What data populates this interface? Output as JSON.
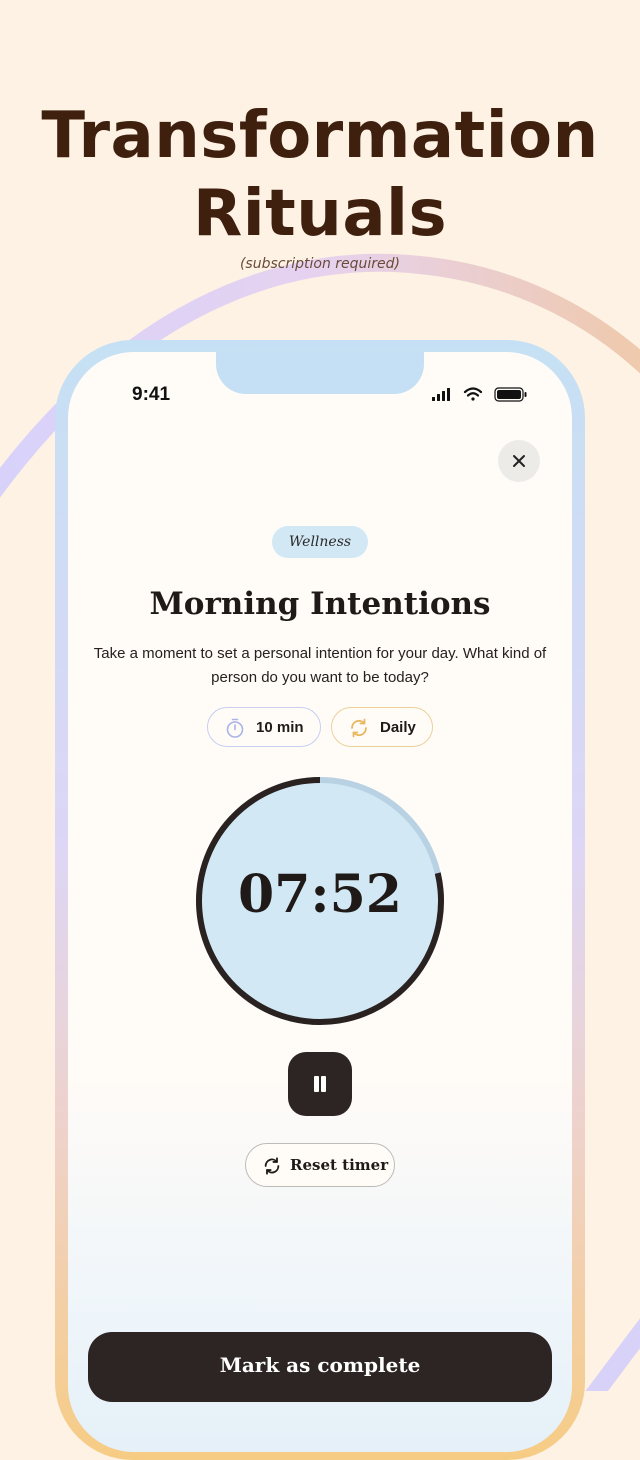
{
  "headline": {
    "line1": "Transformation",
    "line2": "Rituals",
    "note": "(subscription required)"
  },
  "status_bar": {
    "time": "9:41"
  },
  "ritual": {
    "category": "Wellness",
    "title": "Morning Intentions",
    "description": "Take a moment to set a personal intention for your day. What kind of person do you want to be today?",
    "duration": "10 min",
    "frequency": "Daily"
  },
  "timer": {
    "display": "07:52",
    "remaining_fraction": 0.787
  },
  "buttons": {
    "reset": "Reset timer",
    "complete": "Mark as complete"
  },
  "colors": {
    "background": "#fdf2e4",
    "headline": "#3f1f0e",
    "accent_blue": "#d2e8f4",
    "dark": "#2c2523"
  },
  "icons": [
    "close-icon",
    "stopwatch-icon",
    "repeat-icon",
    "pause-icon",
    "reset-icon",
    "signal-icon",
    "wifi-icon",
    "battery-icon"
  ]
}
